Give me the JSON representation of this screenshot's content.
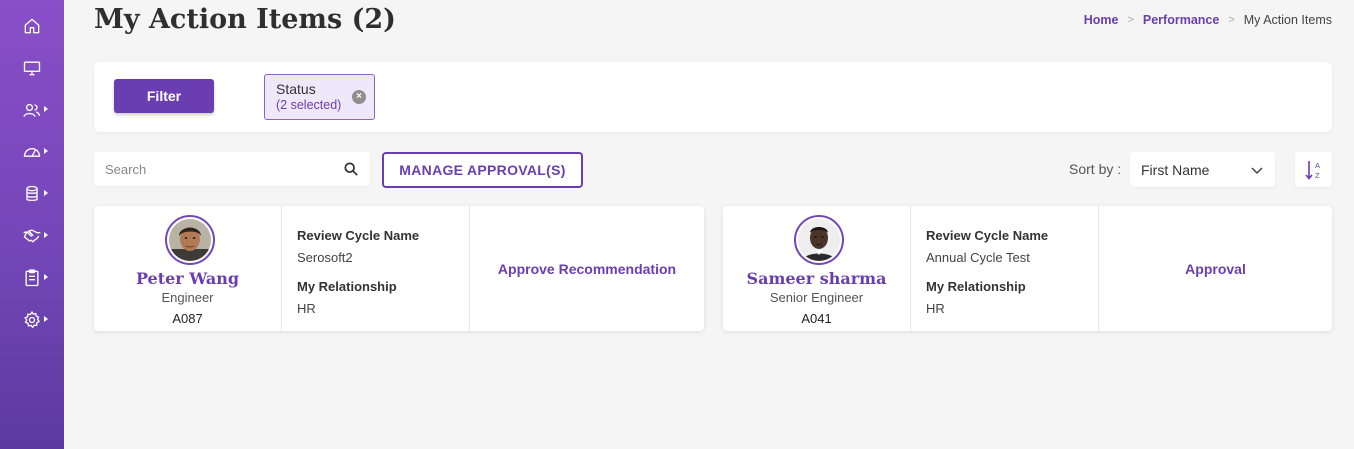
{
  "colors": {
    "accent": "#6a3eb0",
    "sidebar_top": "#8a4fc8",
    "sidebar_bottom": "#5c3aa0",
    "background": "#f5f5f5"
  },
  "sidebar": {
    "items": [
      {
        "icon": "home-icon"
      },
      {
        "icon": "monitor-icon"
      },
      {
        "icon": "users-icon"
      },
      {
        "icon": "dashboard-gauge-icon"
      },
      {
        "icon": "database-icon"
      },
      {
        "icon": "handshake-icon"
      },
      {
        "icon": "clipboard-icon"
      },
      {
        "icon": "settings-gear-icon"
      }
    ]
  },
  "header": {
    "title": "My Action Items (2)",
    "breadcrumb": {
      "home": "Home",
      "section": "Performance",
      "current": "My Action Items",
      "separator": ">"
    }
  },
  "filter_panel": {
    "filter_button": "Filter",
    "chip": {
      "title": "Status",
      "subtitle": "(2 selected)",
      "close": "×"
    }
  },
  "toolbar": {
    "search": {
      "placeholder": "Search",
      "value": ""
    },
    "manage_button": "MANAGE APPROVAL(S)",
    "sort_label": "Sort by :",
    "sort_value": "First Name",
    "sort_direction_icon": "sort-a-z-icon"
  },
  "cards": [
    {
      "name": "Peter Wang",
      "role": "Engineer",
      "id": "A087",
      "review_cycle_label": "Review Cycle Name",
      "review_cycle_value": "Serosoft2",
      "relationship_label": "My Relationship",
      "relationship_value": "HR",
      "action": "Approve Recommendation"
    },
    {
      "name": "Sameer sharma",
      "role": "Senior Engineer",
      "id": "A041",
      "review_cycle_label": "Review Cycle Name",
      "review_cycle_value": "Annual Cycle Test",
      "relationship_label": "My Relationship",
      "relationship_value": "HR",
      "action": "Approval"
    }
  ]
}
